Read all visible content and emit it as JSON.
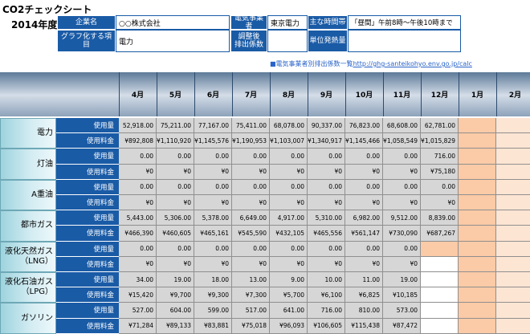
{
  "sheet": {
    "title": "CO2チェックシート",
    "fiscal_year": "2014年度",
    "fields": {
      "company_label": "企業名",
      "company_value": "○○株式会社",
      "utility_label": "電気事業者",
      "utility_value": "東京電力",
      "hours_label": "主な時間帯",
      "hours_value": "「昼間」午前8時～午後10時まで",
      "graph_item_label": "グラフ化する項目",
      "graph_item_value": "電力",
      "adjusted_factor_label": "調整後\n排出係数",
      "unit_heat_label": "単位発熱量"
    },
    "link": {
      "prefix": "■電気事業者別排出係数一覧",
      "url": "http://ghg-santeikohyo.env.go.jp/calc"
    }
  },
  "months": [
    "4月",
    "5月",
    "6月",
    "7月",
    "8月",
    "9月",
    "10月",
    "11月",
    "12月",
    "1月",
    "2月"
  ],
  "sub_labels": {
    "usage": "使用量",
    "cost": "使用料金"
  },
  "categories": [
    {
      "name": "電力",
      "usage": [
        "52,918.00",
        "75,211.00",
        "77,167.00",
        "75,411.00",
        "68,078.00",
        "90,337.00",
        "76,823.00",
        "68,608.00",
        "62,781.00",
        "",
        ""
      ],
      "cost": [
        "¥892,808",
        "¥1,110,920",
        "¥1,145,576",
        "¥1,190,953",
        "¥1,103,007",
        "¥1,340,917",
        "¥1,145,466",
        "¥1,058,549",
        "¥1,015,829",
        "",
        ""
      ]
    },
    {
      "name": "灯油",
      "usage": [
        "0.00",
        "0.00",
        "0.00",
        "0.00",
        "0.00",
        "0.00",
        "0.00",
        "0.00",
        "716.00",
        "",
        ""
      ],
      "cost": [
        "¥0",
        "¥0",
        "¥0",
        "¥0",
        "¥0",
        "¥0",
        "¥0",
        "¥0",
        "¥75,180",
        "",
        ""
      ]
    },
    {
      "name": "A重油",
      "usage": [
        "0.00",
        "0.00",
        "0.00",
        "0.00",
        "0.00",
        "0.00",
        "0.00",
        "0.00",
        "0.00",
        "",
        ""
      ],
      "cost": [
        "¥0",
        "¥0",
        "¥0",
        "¥0",
        "¥0",
        "¥0",
        "¥0",
        "¥0",
        "¥0",
        "",
        ""
      ]
    },
    {
      "name": "都市ガス",
      "usage": [
        "5,443.00",
        "5,306.00",
        "5,378.00",
        "6,649.00",
        "4,917.00",
        "5,310.00",
        "6,982.00",
        "9,512.00",
        "8,839.00",
        "",
        ""
      ],
      "cost": [
        "¥466,390",
        "¥460,605",
        "¥465,161",
        "¥545,590",
        "¥432,105",
        "¥465,556",
        "¥561,147",
        "¥730,090",
        "¥687,267",
        "",
        ""
      ]
    },
    {
      "name": "液化天然ガス\n（LNG）",
      "usage": [
        "0.00",
        "0.00",
        "0.00",
        "0.00",
        "0.00",
        "0.00",
        "0.00",
        "0.00",
        "",
        "",
        ""
      ],
      "cost": [
        "¥0",
        "¥0",
        "¥0",
        "¥0",
        "¥0",
        "¥0",
        "¥0",
        "¥0",
        "",
        "",
        ""
      ]
    },
    {
      "name": "液化石油ガス\n（LPG）",
      "usage": [
        "34.00",
        "19.00",
        "18.00",
        "13.00",
        "9.00",
        "10.00",
        "11.00",
        "19.00",
        "",
        "",
        ""
      ],
      "cost": [
        "¥15,420",
        "¥9,700",
        "¥9,300",
        "¥7,300",
        "¥5,700",
        "¥6,100",
        "¥6,825",
        "¥10,185",
        "",
        "",
        ""
      ]
    },
    {
      "name": "ガソリン",
      "usage": [
        "527.00",
        "604.00",
        "599.00",
        "517.00",
        "641.00",
        "716.00",
        "810.00",
        "573.00",
        "",
        "",
        ""
      ],
      "cost": [
        "¥71,284",
        "¥89,133",
        "¥83,881",
        "¥75,018",
        "¥96,093",
        "¥106,605",
        "¥115,438",
        "¥87,472",
        "",
        "",
        ""
      ]
    }
  ]
}
